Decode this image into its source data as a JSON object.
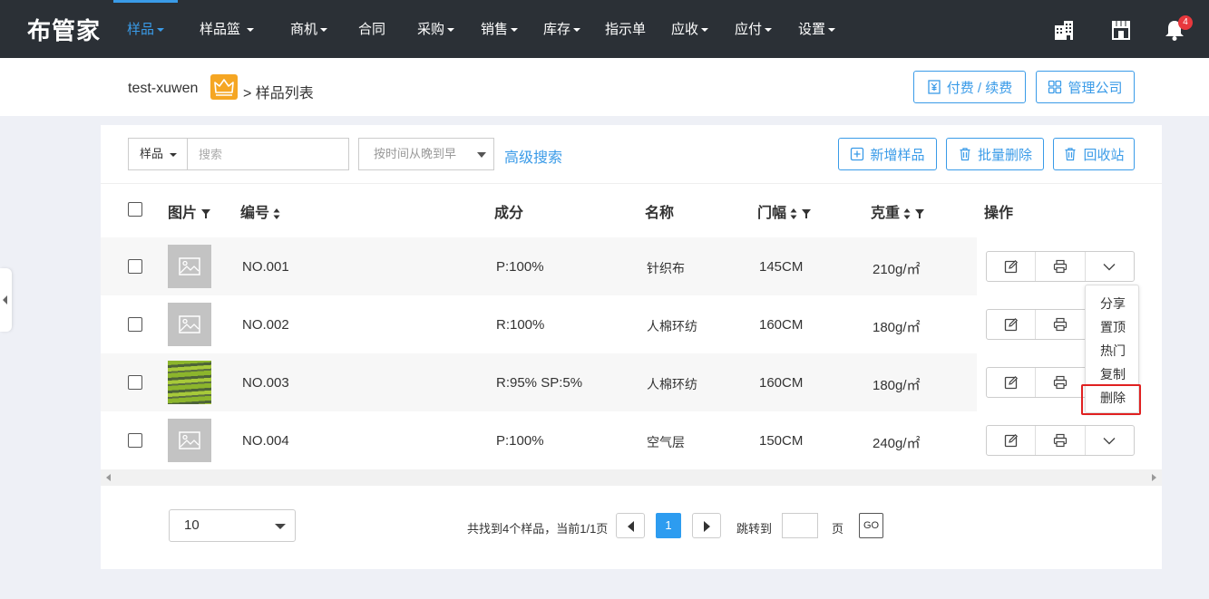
{
  "app": {
    "logo": "布管家"
  },
  "nav": {
    "items": [
      {
        "label": "样品",
        "caret": true,
        "active": true
      },
      {
        "label": "样品篮",
        "caret": true
      },
      {
        "label": "商机",
        "caret": true
      },
      {
        "label": "合同",
        "caret": false
      },
      {
        "label": "采购",
        "caret": true
      },
      {
        "label": "销售",
        "caret": true
      },
      {
        "label": "库存",
        "caret": true
      },
      {
        "label": "指示单",
        "caret": false
      },
      {
        "label": "应收",
        "caret": true
      },
      {
        "label": "应付",
        "caret": true
      },
      {
        "label": "设置",
        "caret": true
      }
    ],
    "notification_count": "4",
    "active_color": "#3a9be8"
  },
  "breadcrumb": {
    "user": "test-xuwen",
    "current": "> 样品列表"
  },
  "header_buttons": {
    "pay": "付费 / 续费",
    "manage": "管理公司"
  },
  "toolbar": {
    "search_type": "样品",
    "search_placeholder": "搜索",
    "sort_placeholder": "按时间从晚到早",
    "advanced_search": "高级搜索",
    "add": "新增样品",
    "batch_delete": "批量删除",
    "recycle": "回收站"
  },
  "table": {
    "headers": {
      "image": "图片",
      "code": "编号",
      "composition": "成分",
      "name": "名称",
      "width": "门幅",
      "weight": "克重",
      "actions": "操作"
    },
    "rows": [
      {
        "code": "NO.001",
        "composition": "P:100%",
        "name": "针织布",
        "width": "145CM",
        "weight": "210g/㎡",
        "image": "placeholder"
      },
      {
        "code": "NO.002",
        "composition": "R:100%",
        "name": "人棉环纺",
        "width": "160CM",
        "weight": "180g/㎡",
        "image": "placeholder"
      },
      {
        "code": "NO.003",
        "composition": "R:95% SP:5%",
        "name": "人棉环纺",
        "width": "160CM",
        "weight": "180g/㎡",
        "image": "photo"
      },
      {
        "code": "NO.004",
        "composition": "P:100%",
        "name": "空气层",
        "width": "150CM",
        "weight": "240g/㎡",
        "image": "placeholder"
      }
    ]
  },
  "dropdown": {
    "items": [
      "分享",
      "置顶",
      "热门",
      "复制",
      "删除"
    ],
    "highlighted": "删除"
  },
  "pagination": {
    "page_size": "10",
    "summary": "共找到4个样品，当前1/1页",
    "current_page": "1",
    "jump_label": "跳转到",
    "page_unit": "页",
    "go": "GO"
  }
}
